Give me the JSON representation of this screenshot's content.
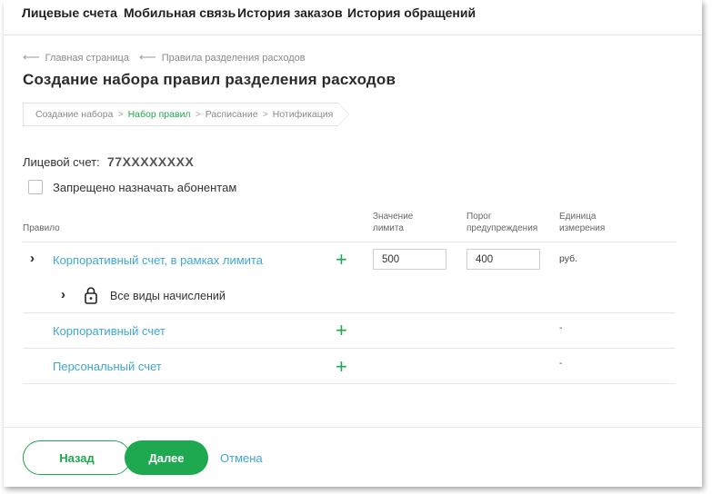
{
  "nav": {
    "items": [
      {
        "label": "Лицевые счета"
      },
      {
        "label": "Мобильная связь"
      },
      {
        "label": "История заказов"
      },
      {
        "label": "История обращений"
      }
    ]
  },
  "breadcrumb": {
    "items": [
      {
        "label": "Главная страница"
      },
      {
        "label": "Правила разделения расходов"
      }
    ]
  },
  "page": {
    "title": "Создание набора правил разделения расходов"
  },
  "stepper": {
    "steps": [
      {
        "label": "Создание набора",
        "active": false
      },
      {
        "label": "Набор правил",
        "active": true
      },
      {
        "label": "Расписание",
        "active": false
      },
      {
        "label": "Нотификация",
        "active": false
      }
    ],
    "separator": ">"
  },
  "account": {
    "label": "Лицевой счет:",
    "value": "77XXXXXXXX"
  },
  "checkbox": {
    "label": "Запрещено назначать абонентам",
    "checked": false
  },
  "table": {
    "headers": {
      "rule": "Правило",
      "limit_value": [
        "Значение",
        "лимита"
      ],
      "warning_threshold": [
        "Порог",
        "предупреждения"
      ],
      "unit": [
        "Единица",
        "измерения"
      ]
    },
    "rows": [
      {
        "rule": "Корпоративный счет, в рамках лимита",
        "limit": "500",
        "threshold": "400",
        "unit": "руб."
      },
      {
        "rule": "Корпоративный счет",
        "unit": "-"
      },
      {
        "rule": "Персональный счет",
        "unit": "-"
      }
    ],
    "sub_row": {
      "label": "Все виды начислений"
    }
  },
  "footer": {
    "back_label": "Назад",
    "next_label": "Далее",
    "cancel_label": "Отмена"
  },
  "colors": {
    "accent": "#1ea84f",
    "link": "#3fa7cf"
  }
}
